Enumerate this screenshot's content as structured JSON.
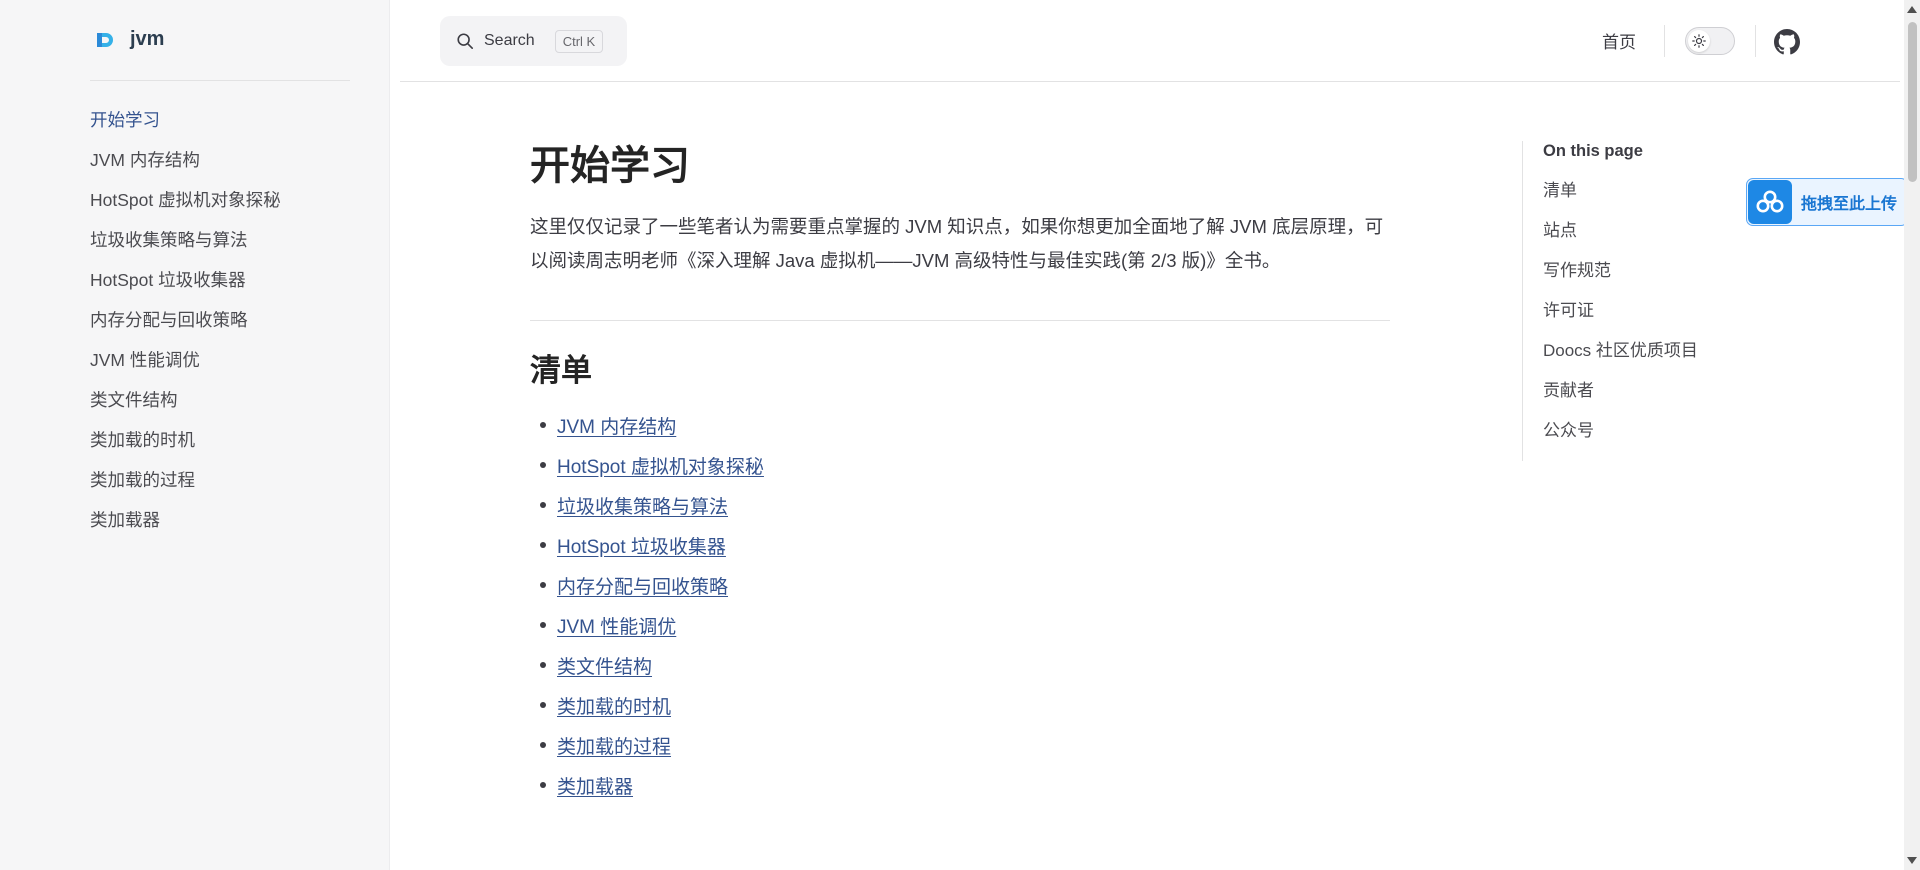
{
  "sidebar": {
    "brand_title": "jvm",
    "items": [
      {
        "label": "开始学习"
      },
      {
        "label": "JVM 内存结构"
      },
      {
        "label": "HotSpot 虚拟机对象探秘"
      },
      {
        "label": "垃圾收集策略与算法"
      },
      {
        "label": "HotSpot 垃圾收集器"
      },
      {
        "label": "内存分配与回收策略"
      },
      {
        "label": "JVM 性能调优"
      },
      {
        "label": "类文件结构"
      },
      {
        "label": "类加载的时机"
      },
      {
        "label": "类加载的过程"
      },
      {
        "label": "类加载器"
      }
    ]
  },
  "topbar": {
    "search_label": "Search",
    "search_shortcut": "Ctrl K",
    "home_label": "首页",
    "theme_toggle_icon": "sun-icon",
    "github_icon": "github-icon"
  },
  "main": {
    "title": "开始学习",
    "intro": "这里仅仅记录了一些笔者认为需要重点掌握的 JVM 知识点，如果你想更加全面地了解 JVM 底层原理，可以阅读周志明老师《深入理解 Java 虚拟机——JVM 高级特性与最佳实践(第 2/3 版)》全书。",
    "section_title": "清单",
    "list": [
      {
        "label": "JVM 内存结构"
      },
      {
        "label": "HotSpot 虚拟机对象探秘"
      },
      {
        "label": "垃圾收集策略与算法"
      },
      {
        "label": "HotSpot 垃圾收集器"
      },
      {
        "label": "内存分配与回收策略"
      },
      {
        "label": "JVM 性能调优"
      },
      {
        "label": "类文件结构"
      },
      {
        "label": "类加载的时机"
      },
      {
        "label": "类加载的过程"
      },
      {
        "label": "类加载器"
      }
    ]
  },
  "outline": {
    "title": "On this page",
    "items": [
      {
        "label": "清单"
      },
      {
        "label": "站点"
      },
      {
        "label": "写作规范"
      },
      {
        "label": "许可证"
      },
      {
        "label": "Doocs 社区优质项目"
      },
      {
        "label": "贡献者"
      },
      {
        "label": "公众号"
      }
    ]
  },
  "upload_widget": {
    "label": "拖拽至此上传",
    "icon": "cloud-icon"
  },
  "colors": {
    "accent": "#34538f",
    "sidebar_bg": "#f6f6f7",
    "upload_blue": "#1e88e5"
  }
}
